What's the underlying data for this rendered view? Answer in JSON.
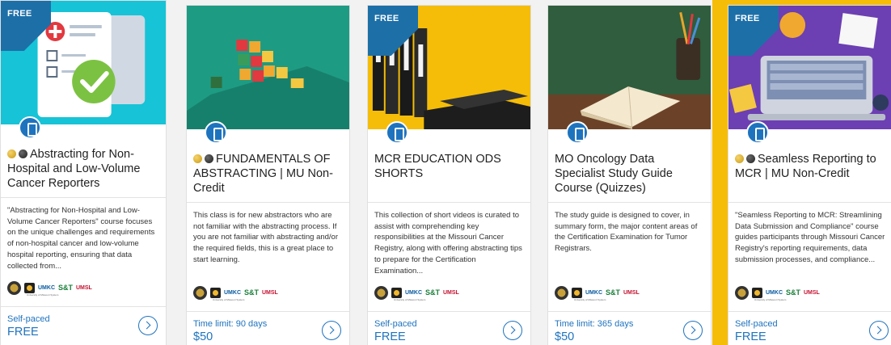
{
  "ribbon_label": "FREE",
  "colors": {
    "accent": "#1e73be",
    "ribbon": "#1d6fa8",
    "highlight_bg": "#f5bd07"
  },
  "logos": {
    "umkc": "UMKC",
    "st": "S&T",
    "umsl": "UMSL",
    "caption": "University of Missouri System"
  },
  "courses": [
    {
      "free_ribbon": true,
      "title": "Abstracting for Non-Hospital and Low-Volume Cancer Reporters",
      "description": "\"Abstracting for Non-Hospital and Low-Volume Cancer Reporters\" course focuses on the unique challenges and requirements of non-hospital cancer and low-volume hospital reporting, ensuring that data collected from...",
      "pace": "Self-paced",
      "price": "FREE",
      "badges": true
    },
    {
      "free_ribbon": false,
      "title": "FUNDAMENTALS OF ABSTRACTING | MU Non-Credit",
      "description": "This class is for new abstractors who are not familiar with the abstracting process. If you are not familiar with abstracting and/or the required fields, this is a great place to start learning.",
      "pace": "Time limit: 90 days",
      "price": "$50",
      "badges": true
    },
    {
      "free_ribbon": true,
      "title": "MCR EDUCATION ODS SHORTS",
      "description": "This collection of short videos is curated to assist with comprehending key responsibilities at the Missouri Cancer Registry, along with offering abstracting tips to prepare for the Certification Examination...",
      "pace": "Self-paced",
      "price": "FREE",
      "badges": false
    },
    {
      "free_ribbon": false,
      "title": "MO Oncology Data Specialist Study Guide Course (Quizzes)",
      "description": "The study guide is designed to cover, in summary form, the major content areas of the Certification Examination for Tumor Registrars.",
      "pace": "Time limit: 365 days",
      "price": "$50",
      "badges": false
    },
    {
      "free_ribbon": true,
      "title": "Seamless Reporting to MCR | MU Non-Credit",
      "description": "\"Seamless Reporting to MCR: Streamlining Data Submission and Compliance\" course guides participants through Missouri Cancer Registry's reporting requirements, data submission processes, and compliance...",
      "pace": "Self-paced",
      "price": "FREE",
      "badges": true
    }
  ]
}
